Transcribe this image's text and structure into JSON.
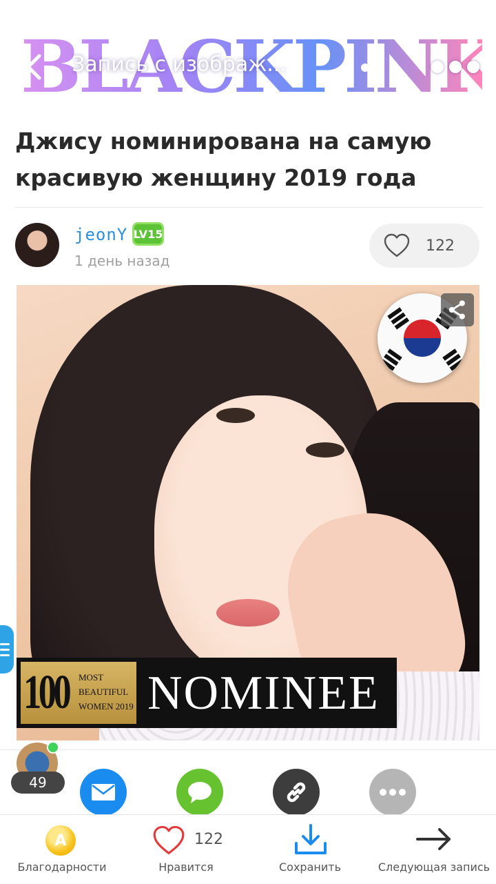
{
  "header": {
    "banner_text": "BLACKPINK",
    "title": "Запись с изображ...",
    "back_icon": "chevron-left-icon",
    "share_icon": "share-icon",
    "more_icon": "more-horizontal-icon"
  },
  "post": {
    "title": "Джису номинирована на самую красивую женщину 2019 года",
    "author": {
      "name": "jeonY",
      "level": "LV15",
      "time": "1 день назад"
    },
    "likes": "122",
    "image": {
      "nominee_number": "100",
      "nominee_sub": [
        "MOST",
        "BEAUTIFUL",
        "WOMEN 2019"
      ],
      "nominee_text": "NOMINEE"
    }
  },
  "share_row": {
    "viewer_count": "49",
    "buttons": [
      {
        "name": "email",
        "icon": "envelope-icon",
        "color": "#1a8cf0"
      },
      {
        "name": "chat",
        "icon": "chat-bubble-icon",
        "color": "#66c22f"
      },
      {
        "name": "link",
        "icon": "link-icon",
        "color": "#3d3d3d"
      },
      {
        "name": "more",
        "icon": "more-horizontal-icon",
        "color": "#b5b5b5"
      }
    ]
  },
  "bottom_bar": {
    "thanks": "Благодарности",
    "like": "Нравится",
    "like_count": "122",
    "save": "Сохранить",
    "next": "Следующая запись"
  },
  "colors": {
    "accent_blue": "#2b8fe0",
    "level_green": "#5cc236",
    "coin": "#f6c21b"
  }
}
